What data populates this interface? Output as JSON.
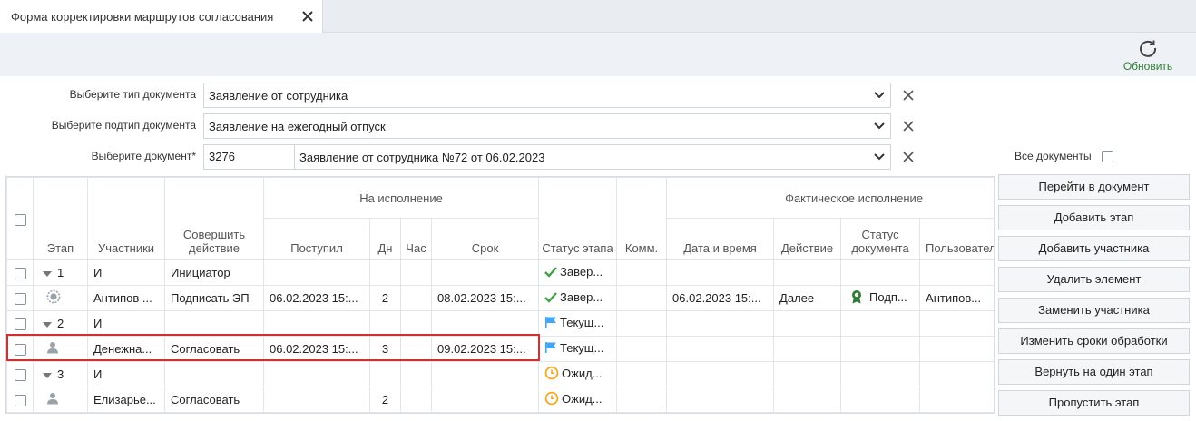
{
  "tab": {
    "title": "Форма корректировки маршрутов согласования"
  },
  "toolbar": {
    "refresh_label": "Обновить"
  },
  "filters": {
    "doc_type_label": "Выберите тип документа",
    "doc_type_value": "Заявление от сотрудника",
    "doc_subtype_label": "Выберите подтип документа",
    "doc_subtype_value": "Заявление на ежегодный отпуск",
    "doc_label": "Выберите документ*",
    "doc_id": "3276",
    "doc_value": "Заявление от сотрудника №72 от 06.02.2023",
    "all_docs_label": "Все документы"
  },
  "table": {
    "group_exec": "На исполнение",
    "group_actual": "Фактическое исполнение",
    "columns": {
      "stage": "Этап",
      "participants": "Участники",
      "action": "Совершить действие",
      "received": "Поступил",
      "days": "Дн",
      "hours": "Час",
      "deadline": "Срок",
      "stage_status": "Статус этапа",
      "comment": "Комм.",
      "datetime": "Дата и время",
      "act": "Действие",
      "doc_status": "Статус документа",
      "user": "Пользовател"
    },
    "rows": [
      {
        "stage": "1",
        "participant": "И",
        "action": "Инициатор",
        "received": "",
        "days": "",
        "deadline": "",
        "status": "Завер...",
        "datetime": "",
        "act": "",
        "doc_status": "",
        "user": ""
      },
      {
        "stage": "",
        "participant": "Антипов ...",
        "action": "Подписать ЭП",
        "received": "06.02.2023 15:...",
        "days": "2",
        "deadline": "08.02.2023 15:...",
        "status": "Завер...",
        "datetime": "06.02.2023 15:...",
        "act": "Далее",
        "doc_status": "Подп...",
        "user": "Антипов..."
      },
      {
        "stage": "2",
        "participant": "И",
        "action": "",
        "received": "",
        "days": "",
        "deadline": "",
        "status": "Текущ...",
        "datetime": "",
        "act": "",
        "doc_status": "",
        "user": ""
      },
      {
        "stage": "",
        "participant": "Денежна...",
        "action": "Согласовать",
        "received": "06.02.2023 15:...",
        "days": "3",
        "deadline": "09.02.2023 15:...",
        "status": "Текущ...",
        "datetime": "",
        "act": "",
        "doc_status": "",
        "user": ""
      },
      {
        "stage": "3",
        "participant": "И",
        "action": "",
        "received": "",
        "days": "",
        "deadline": "",
        "status": "Ожид...",
        "datetime": "",
        "act": "",
        "doc_status": "",
        "user": ""
      },
      {
        "stage": "",
        "participant": "Елизарье...",
        "action": "Согласовать",
        "received": "",
        "days": "2",
        "deadline": "",
        "status": "Ожид...",
        "datetime": "",
        "act": "",
        "doc_status": "",
        "user": ""
      }
    ]
  },
  "buttons": {
    "open_doc": "Перейти в документ",
    "add_stage": "Добавить этап",
    "add_participant": "Добавить участника",
    "delete": "Удалить элемент",
    "replace": "Заменить участника",
    "change_terms": "Изменить сроки обработки",
    "back": "Вернуть на один этап",
    "skip": "Пропустить этап"
  },
  "colors": {
    "accent_green": "#2e7d32",
    "check_green": "#43a047",
    "flag_blue": "#42a5f5",
    "clock_orange": "#f5a623",
    "highlight_red": "#d32f2f"
  }
}
